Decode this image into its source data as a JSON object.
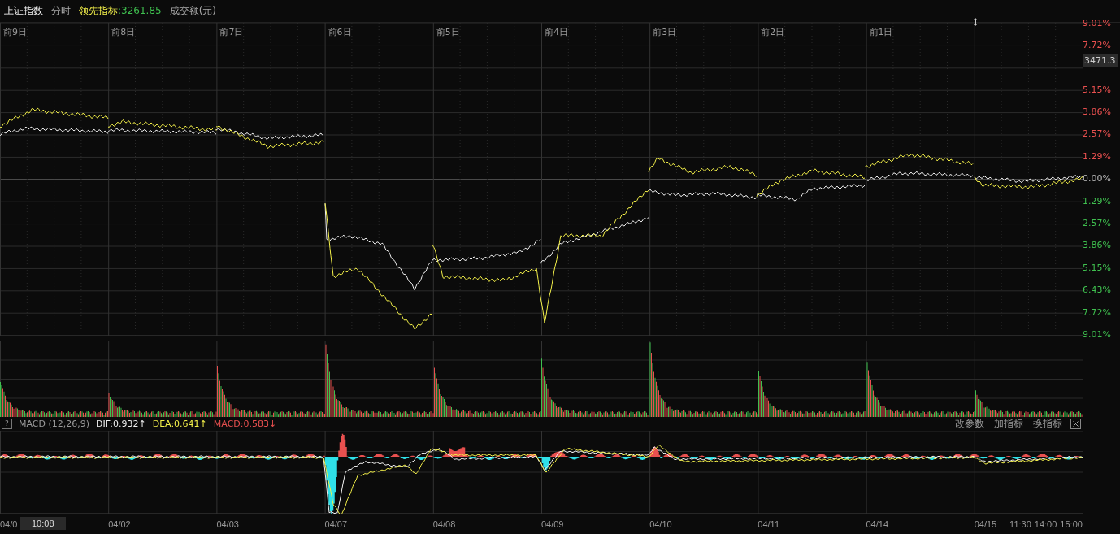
{
  "header": {
    "symbol": "上证指数",
    "mode": "分时",
    "indicator_label": "领先指标",
    "indicator_value": ":3261.85",
    "volume_label": "成交额(元)"
  },
  "day_labels": [
    "前9日",
    "前8日",
    "前7日",
    "前6日",
    "前5日",
    "前4日",
    "前3日",
    "前2日",
    "前1日"
  ],
  "price_axis": [
    {
      "label": "9.01%",
      "kind": "up"
    },
    {
      "label": "7.72%",
      "kind": "up"
    },
    {
      "label": "3471.3",
      "kind": "price"
    },
    {
      "label": "5.15%",
      "kind": "up"
    },
    {
      "label": "3.86%",
      "kind": "up"
    },
    {
      "label": "2.57%",
      "kind": "up"
    },
    {
      "label": "1.29%",
      "kind": "up"
    },
    {
      "label": "0.00%",
      "kind": "zero"
    },
    {
      "label": "1.29%",
      "kind": "down"
    },
    {
      "label": "2.57%",
      "kind": "down"
    },
    {
      "label": "3.86%",
      "kind": "down"
    },
    {
      "label": "5.15%",
      "kind": "down"
    },
    {
      "label": "6.43%",
      "kind": "down"
    },
    {
      "label": "7.72%",
      "kind": "down"
    },
    {
      "label": "9.01%",
      "kind": "down"
    }
  ],
  "macd": {
    "help": "?",
    "name": "MACD (12,26,9)",
    "values": [
      {
        "text": "DIF:0.932↑",
        "kind": "dif"
      },
      {
        "text": "DEA:0.641↑",
        "kind": "dea"
      },
      {
        "text": "MACD:0.583↓",
        "kind": "macd"
      }
    ],
    "buttons": [
      "改参数",
      "加指标",
      "换指标"
    ]
  },
  "date_axis": {
    "dates": [
      "04/0",
      "04/02",
      "04/03",
      "04/07",
      "04/08",
      "04/09",
      "04/10",
      "04/11",
      "04/14",
      "04/15"
    ],
    "times": [
      "11:30",
      "14:00",
      "15:00"
    ],
    "cursor_time": "10:08"
  }
}
